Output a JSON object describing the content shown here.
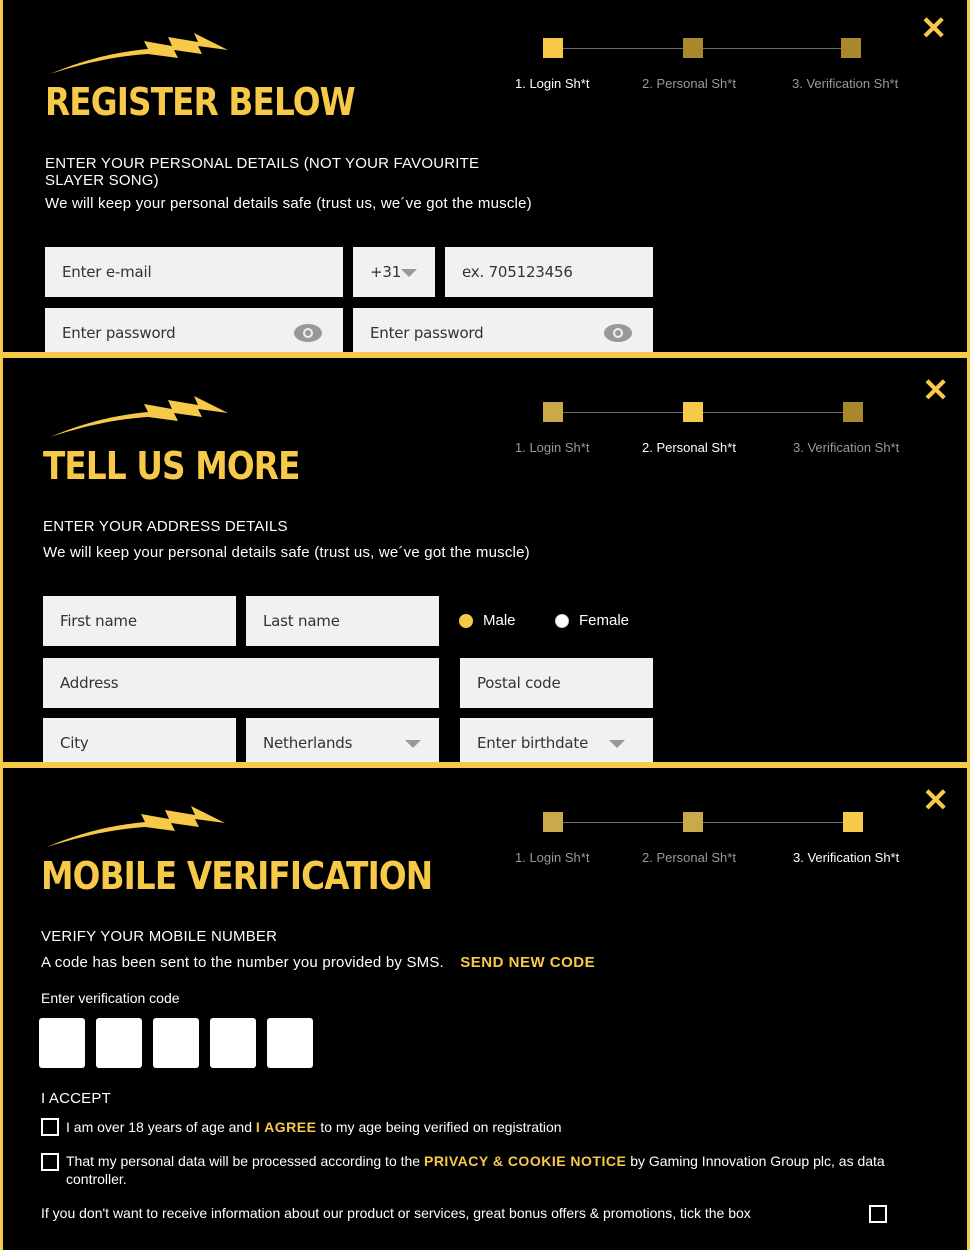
{
  "colors": {
    "accent": "#f7c948",
    "step_done": "#c9a94a",
    "step_pending": "#a8882a",
    "background": "#000000"
  },
  "icons": {
    "close": "close-icon",
    "logo": "lightning-bolt-icon",
    "eye": "eye-icon",
    "chevron": "chevron-down-icon"
  },
  "close_glyph": "✕",
  "steps": [
    "1. Login Sh*t",
    "2. Personal Sh*t",
    "3. Verification Sh*t"
  ],
  "screen1": {
    "title": "REGISTER BELOW",
    "active_step": 1,
    "subtitle": "ENTER YOUR PERSONAL DETAILS (NOT YOUR FAVOURITE SLAYER SONG)",
    "note": "We will keep your personal details safe (trust us, we´ve got the muscle)",
    "email_placeholder": "Enter e-mail",
    "country_code": "+31",
    "phone_placeholder": "ex. 705123456",
    "password_placeholder": "Enter password",
    "password_confirm_placeholder": "Enter password"
  },
  "screen2": {
    "title": "TELL US MORE",
    "active_step": 2,
    "subtitle": "ENTER YOUR ADDRESS DETAILS",
    "note": "We will keep your personal details safe (trust us, we´ve got the muscle)",
    "first_name_placeholder": "First name",
    "last_name_placeholder": "Last name",
    "gender_options": [
      "Male",
      "Female"
    ],
    "gender_selected": "Male",
    "address_placeholder": "Address",
    "postal_code_placeholder": "Postal code",
    "city_placeholder": "City",
    "country_value": "Netherlands",
    "birthdate_placeholder": "Enter birthdate"
  },
  "screen3": {
    "title": "MOBILE VERIFICATION",
    "active_step": 3,
    "subtitle": "VERIFY YOUR MOBILE NUMBER",
    "note": "A code has been sent to the number you provided by SMS.",
    "send_new_code": "SEND NEW CODE",
    "code_label": "Enter verification code",
    "code_digits": 5,
    "accept_heading": "I ACCEPT",
    "age_pre": "I am over 18 years of age and",
    "age_link": "I AGREE",
    "age_post": "to my age being verified on registration",
    "privacy_pre": "That my personal data will be processed according to the",
    "privacy_link": "PRIVACY & COOKIE NOTICE",
    "privacy_post": "by Gaming Innovation Group plc, as data controller.",
    "marketing_text": "If you don't want to receive information about our product or services, great bonus offers & promotions, tick the box"
  }
}
